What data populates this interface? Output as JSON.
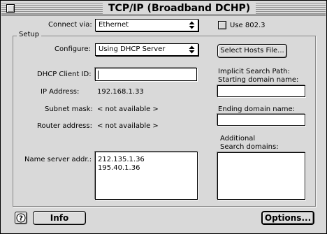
{
  "window": {
    "title": "TCP/IP (Broadband DCHP)"
  },
  "connect": {
    "label": "Connect via:",
    "value": "Ethernet",
    "use8023_label": "Use 802.3",
    "use8023_checked": false
  },
  "setup": {
    "group_title": "Setup",
    "configure_label": "Configure:",
    "configure_value": "Using DHCP Server",
    "select_hosts_button": "Select Hosts File...",
    "dhcp_client_id_label": "DHCP Client ID:",
    "dhcp_client_id_value": "",
    "ip_address_label": "IP Address:",
    "ip_address_value": "192.168.1.33",
    "subnet_mask_label": "Subnet mask:",
    "subnet_mask_value": "< not available >",
    "router_address_label": "Router address:",
    "router_address_value": "< not available >",
    "name_server_label": "Name server addr.:",
    "name_servers": [
      "212.135.1.36",
      "195.40.1.36"
    ],
    "implicit_search_label": "Implicit Search Path:",
    "starting_domain_label": "Starting domain name:",
    "starting_domain_value": "",
    "ending_domain_label": "Ending domain name:",
    "ending_domain_value": "",
    "additional_search_label_1": "Additional",
    "additional_search_label_2": "Search domains:",
    "additional_search_value": ""
  },
  "footer": {
    "help_glyph": "?",
    "info_button": "Info",
    "options_button": "Options..."
  }
}
